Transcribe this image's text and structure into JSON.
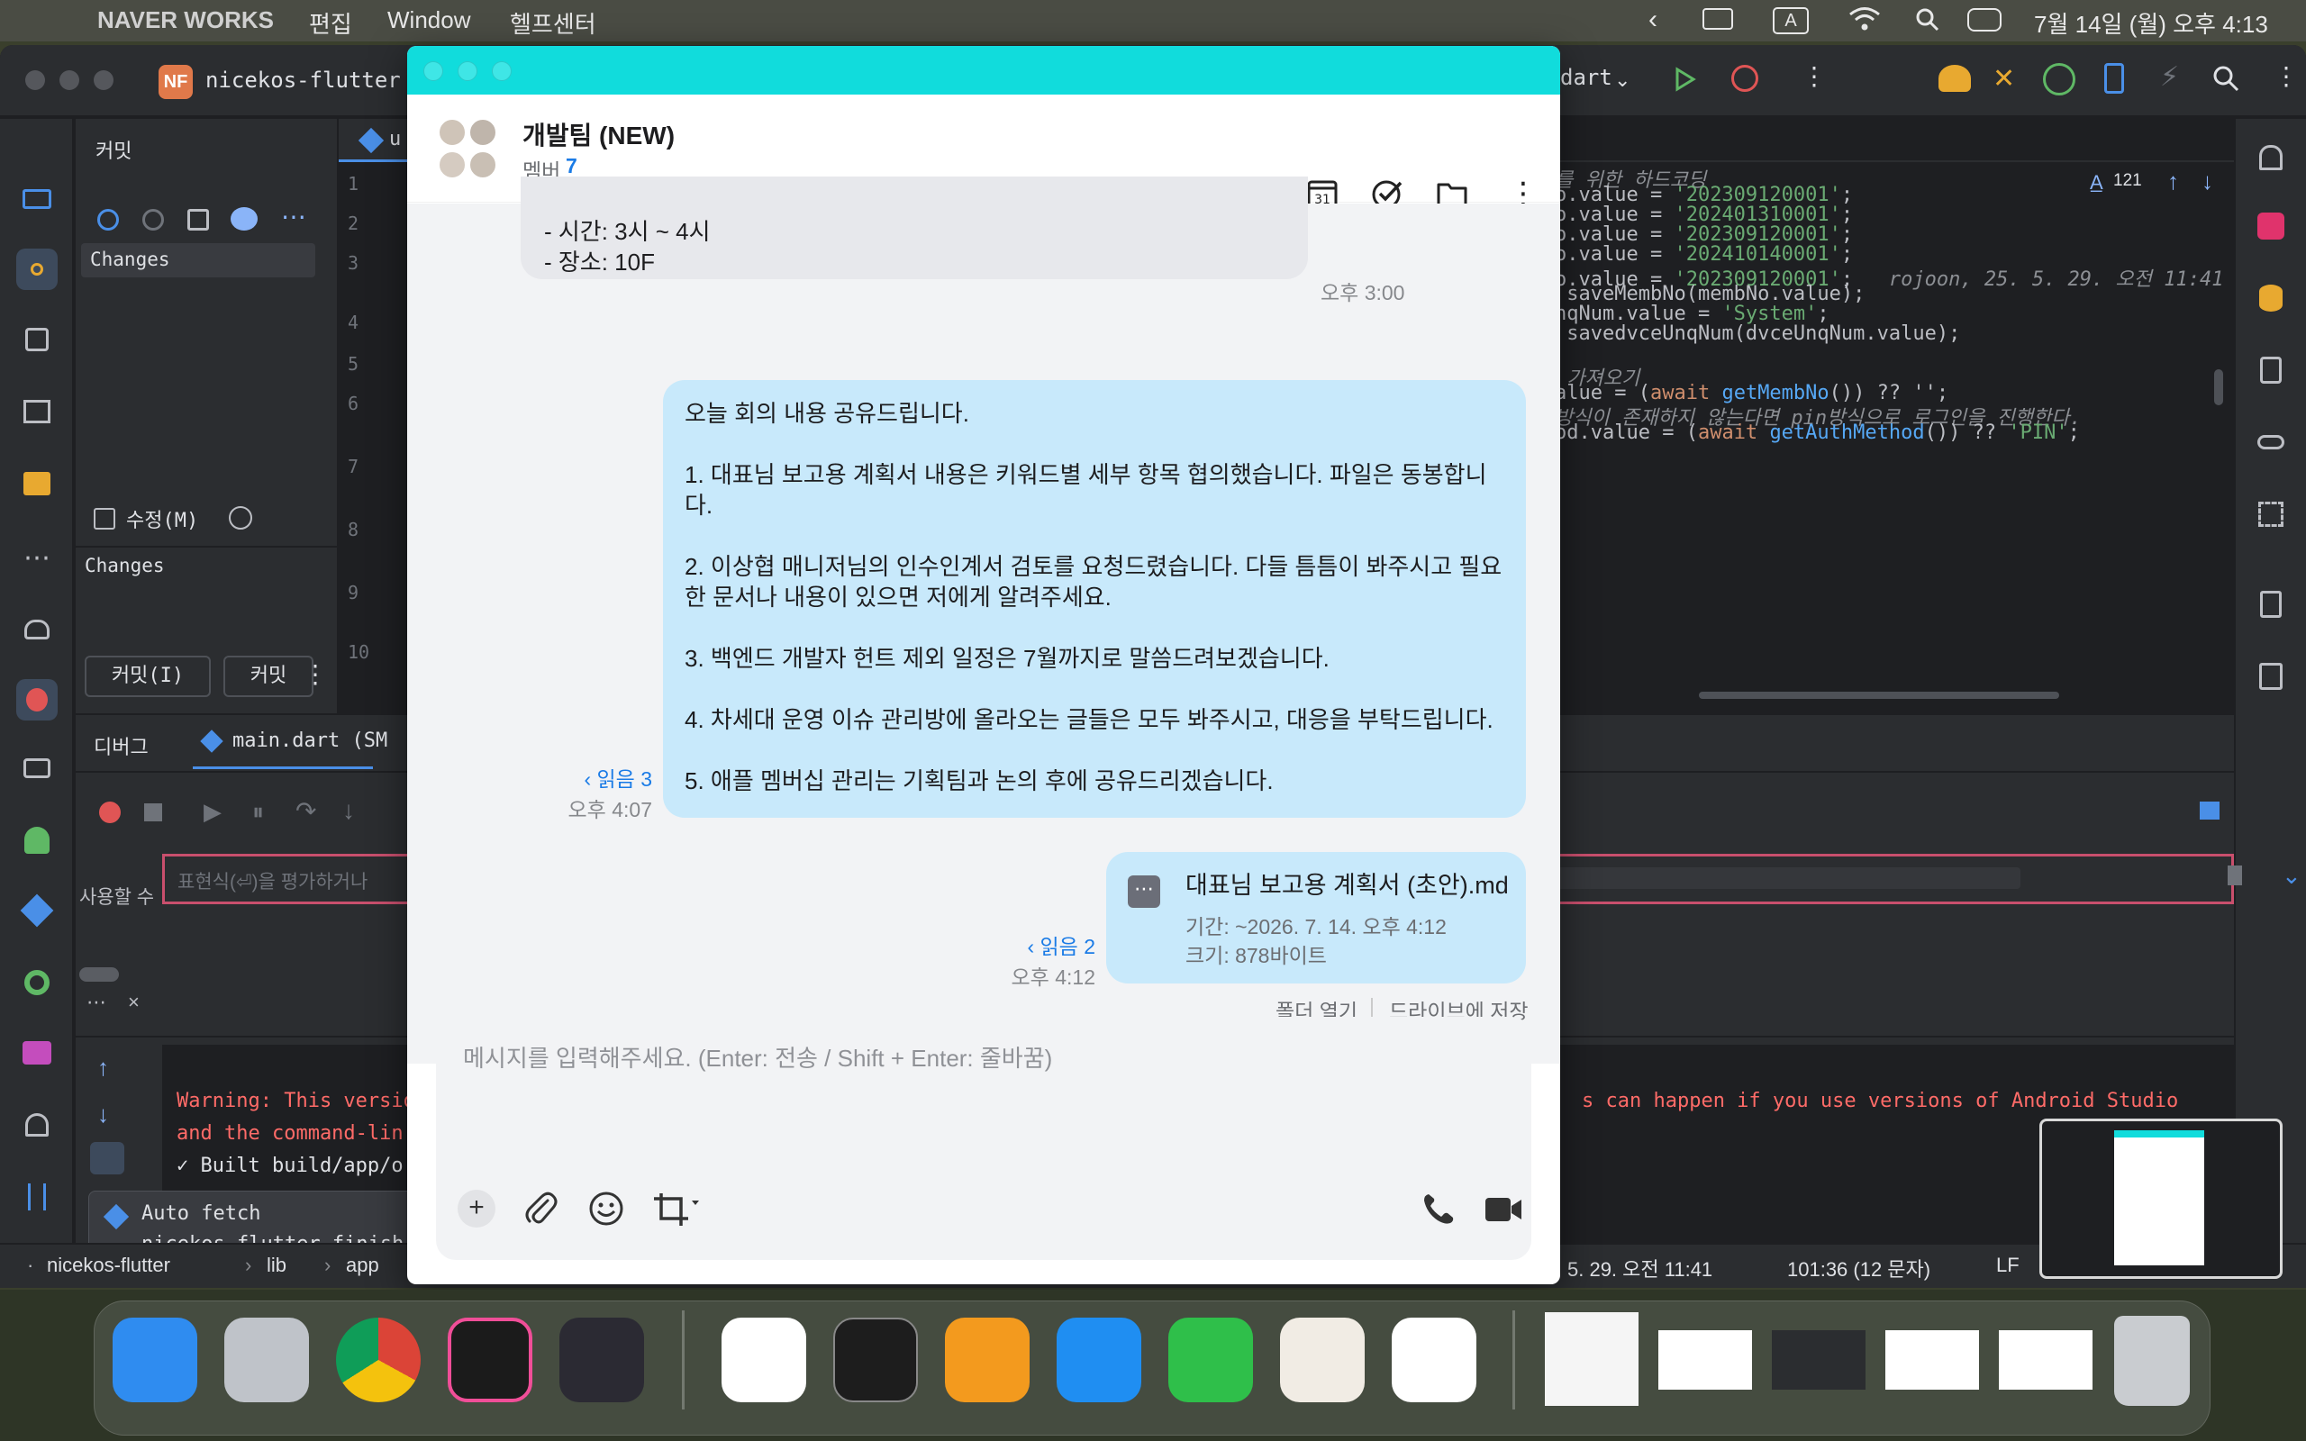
{
  "menubar": {
    "app_name": "NAVER WORKS",
    "menus": [
      "편집",
      "Window",
      "헬프센터"
    ],
    "clock": "7월 14일 (월) 오후 4:13",
    "input_indicator": "A"
  },
  "ide": {
    "project_badge": "NF",
    "project_name": "nicekos-flutter",
    "tab_left": "u",
    "run_config": "dart",
    "commit_panel": {
      "title": "커밋",
      "changes_label": "Changes",
      "amend_label": "수정(M)",
      "changes_label2": "Changes",
      "commit_button": "커밋(I)",
      "commit_push_button": "커밋"
    },
    "gutter_lines": [
      "1",
      "2",
      "3",
      "4",
      "5",
      "6",
      "7",
      "8",
      "9",
      "10"
    ],
    "editor_lines": [
      {
        "segments": [
          {
            "t": "를 위한 하드코딩",
            "c": "cm"
          }
        ]
      },
      {
        "segments": [
          {
            "t": "o.value = ",
            "c": "p"
          },
          {
            "t": "'202309120001'",
            "c": "s"
          },
          {
            "t": ";",
            "c": "p"
          }
        ]
      },
      {
        "segments": [
          {
            "t": "o.value = ",
            "c": "p"
          },
          {
            "t": "'202401310001'",
            "c": "s"
          },
          {
            "t": ";",
            "c": "p"
          }
        ]
      },
      {
        "segments": [
          {
            "t": "o.value = ",
            "c": "p"
          },
          {
            "t": "'202309120001'",
            "c": "s"
          },
          {
            "t": ";",
            "c": "p"
          }
        ]
      },
      {
        "segments": [
          {
            "t": "o.value = ",
            "c": "p"
          },
          {
            "t": "'202410140001'",
            "c": "s"
          },
          {
            "t": ";",
            "c": "p"
          }
        ]
      },
      {
        "segments": [
          {
            "t": "o.value = ",
            "c": "p"
          },
          {
            "t": "'202309120001'",
            "c": "s"
          },
          {
            "t": ";",
            "c": "p"
          },
          {
            "t": "   rojoon, 25. 5. 29. 오전 11:41",
            "c": "cm"
          }
        ]
      },
      {
        "segments": [
          {
            "t": " saveMembNo",
            "c": "p"
          },
          {
            "t": "(membNo.value);",
            "c": "p"
          }
        ]
      },
      {
        "segments": [
          {
            "t": "nqNum.value = ",
            "c": "p"
          },
          {
            "t": "'System'",
            "c": "s"
          },
          {
            "t": ";",
            "c": "p"
          }
        ]
      },
      {
        "segments": [
          {
            "t": " savedvceUnqNum",
            "c": "p"
          },
          {
            "t": "(dvceUnqNum.value);",
            "c": "p"
          }
        ]
      },
      {
        "segments": [
          {
            "t": "",
            "c": "p"
          }
        ]
      },
      {
        "segments": [
          {
            "t": " 가져오기",
            "c": "cm"
          }
        ]
      },
      {
        "segments": [
          {
            "t": "alue = (",
            "c": "p"
          },
          {
            "t": "await ",
            "c": "k"
          },
          {
            "t": "getMembNo",
            "c": "f"
          },
          {
            "t": "()) ?? '';",
            "c": "p"
          }
        ]
      },
      {
        "segments": [
          {
            "t": "방식이 존재하지 않는다면 pin방식으로 로그인을 진행한다.",
            "c": "cm"
          }
        ]
      },
      {
        "segments": [
          {
            "t": "od.value = (",
            "c": "p"
          },
          {
            "t": "await ",
            "c": "k"
          },
          {
            "t": "getAuthMethod",
            "c": "f"
          },
          {
            "t": "()) ?? ",
            "c": "p"
          },
          {
            "t": "'PIN'",
            "c": "s"
          },
          {
            "t": ";",
            "c": "p"
          }
        ]
      }
    ],
    "warning_count": "121",
    "debug": {
      "tab": "디버그",
      "session": "main.dart (SM",
      "eval_label": "사용할 수",
      "eval_placeholder": "표현식(⏎)을 평가하거나",
      "console": [
        "Warning: This versio",
        "and the command-lin",
        "✓  Built build/app/o"
      ],
      "console_right": "s can happen if you use versions of Android Studio"
    },
    "notification": {
      "title": "Auto fetch",
      "body": "nicekos-flutter finish"
    },
    "status": {
      "breadcrumb": [
        "nicekos-flutter",
        "lib",
        "app"
      ],
      "right": [
        "5. 29. 오전 11:41",
        "101:36 (12 문자)",
        "LF"
      ]
    }
  },
  "chat": {
    "title": "개발팀 (NEW)",
    "members_label": "멤버",
    "members_count": "7",
    "messages": {
      "prev_line1": "- 시간: 3시 ~ 4시",
      "prev_line2": "- 장소: 10F",
      "prev_time": "오후 3:00",
      "main_paragraphs": [
        "오늘 회의 내용 공유드립니다.",
        "1. 대표님 보고용 계획서 내용은 키워드별 세부 항목 협의했습니다. 파일은 동봉합니다.",
        "2. 이상협 매니저님의 인수인계서 검토를 요청드렸습니다. 다들 틈틈이 봐주시고 필요한 문서나 내용이 있으면 저에게 알려주세요.",
        "3. 백엔드 개발자 헌트 제외 일정은 7월까지로 말씀드려보겠습니다.",
        "4. 차세대 운영 이슈 관리방에 올라오는 글들은 모두 봐주시고, 대응을 부탁드립니다.",
        "5. 애플 멤버십 관리는 기획팀과 논의 후에 공유드리겠습니다."
      ],
      "main_read": "‹ 읽음 3",
      "main_time": "오후 4:07",
      "file_name": "대표님 보고용 계획서 (초안).md",
      "file_period": "기간: ~2026. 7. 14. 오후 4:12",
      "file_size": "크기: 878바이트",
      "file_read": "‹ 읽음 2",
      "file_time": "오후 4:12",
      "file_open_folder": "폴더 열기",
      "file_save_drive": "드라이브에 저장"
    },
    "input_placeholder": "메시지를 입력해주세요. (Enter: 전송 / Shift + Enter: 줄바꿈)"
  },
  "dock": {
    "apps": [
      "finder-icon",
      "launchpad-icon",
      "chrome-icon",
      "intellij-icon",
      "obsidian-icon",
      "naver-works-icon",
      "terminal-icon",
      "pages-icon",
      "keynote-icon",
      "numbers-icon",
      "dbeaver-icon",
      "naver-box-icon"
    ],
    "windows": [
      "doc-window-thumb",
      "chat-window-thumb-1",
      "ide-window-thumb",
      "chat-window-thumb-2",
      "chat-window-thumb-3"
    ],
    "trash": "trash-icon"
  },
  "colors": {
    "chat_titlebar": "#11dcdc",
    "outgoing_bubble": "#c8e9fb",
    "incoming_bubble": "#e7e8ec",
    "read_receipt": "#1a7be6",
    "ide_bg": "#1e1f22",
    "ide_panel": "#2b2d30",
    "string": "#6aab73",
    "keyword": "#cf8e6d",
    "function": "#56a8f5"
  }
}
